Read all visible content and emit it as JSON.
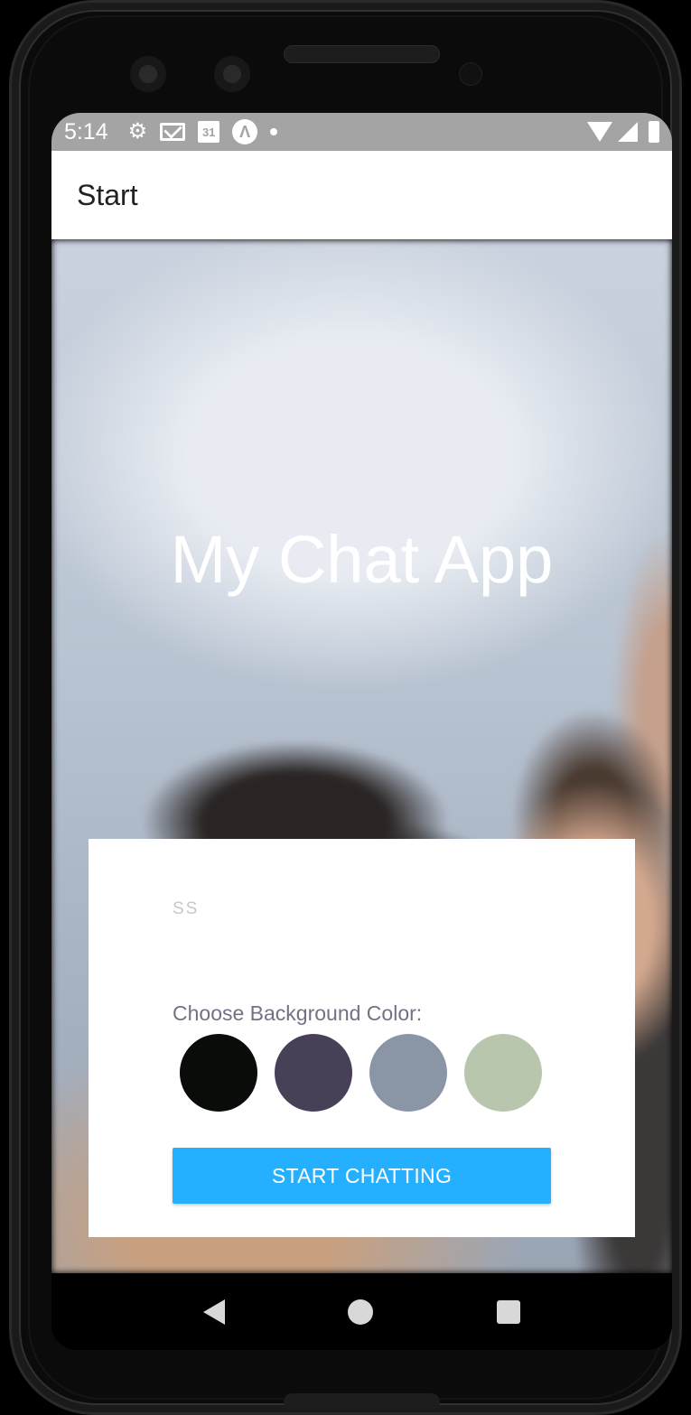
{
  "status_bar": {
    "time": "5:14",
    "icons": [
      "gear-icon",
      "mail-icon",
      "calendar-icon",
      "app-a-icon",
      "dot-icon",
      "wifi-icon",
      "signal-icon",
      "battery-icon"
    ],
    "calendar_day": "31",
    "app_letter": "Λ"
  },
  "app_bar": {
    "title": "Start"
  },
  "hero": {
    "title": "My Chat App"
  },
  "form": {
    "name_placeholder": "SS",
    "choose_label": "Choose Background Color:",
    "colors": [
      "#090C08",
      "#474056",
      "#8A95A5",
      "#B9C6AE"
    ],
    "start_button_label": "START CHATTING",
    "start_button_color": "#25b0ff"
  },
  "nav_bar": {
    "icons": [
      "back-icon",
      "home-icon",
      "recents-icon"
    ]
  }
}
